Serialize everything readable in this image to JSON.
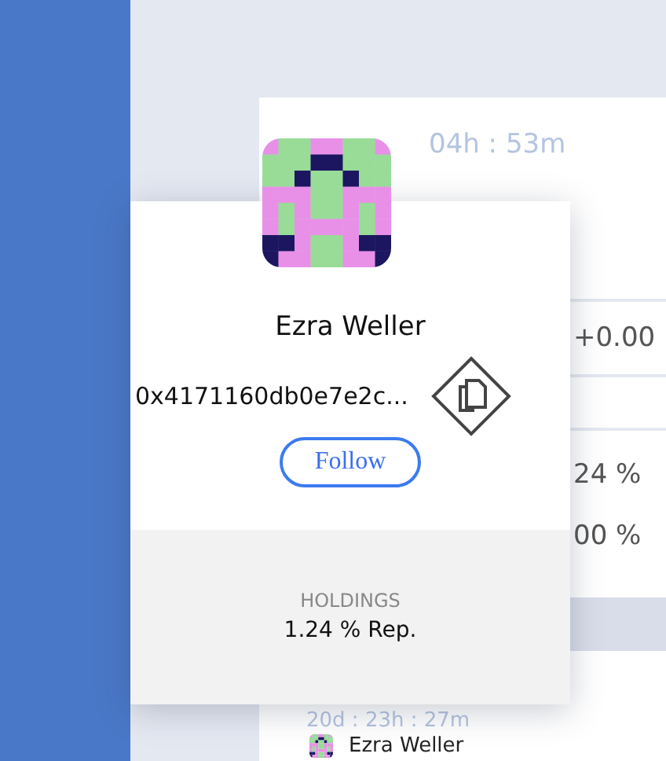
{
  "background_card": {
    "timer": "04h : 53m",
    "change": "+0.00",
    "share_1": "24 %",
    "share_2": "00 %",
    "timer_2": "20d : 23h : 27m",
    "owner": "Ezra Weller"
  },
  "profile_popup": {
    "name": "Ezra Weller",
    "address": "0x4171160db0e7e2c...",
    "follow_button": "Follow",
    "holdings_label": "HOLDINGS",
    "holdings_value": "1.24 % Rep."
  }
}
